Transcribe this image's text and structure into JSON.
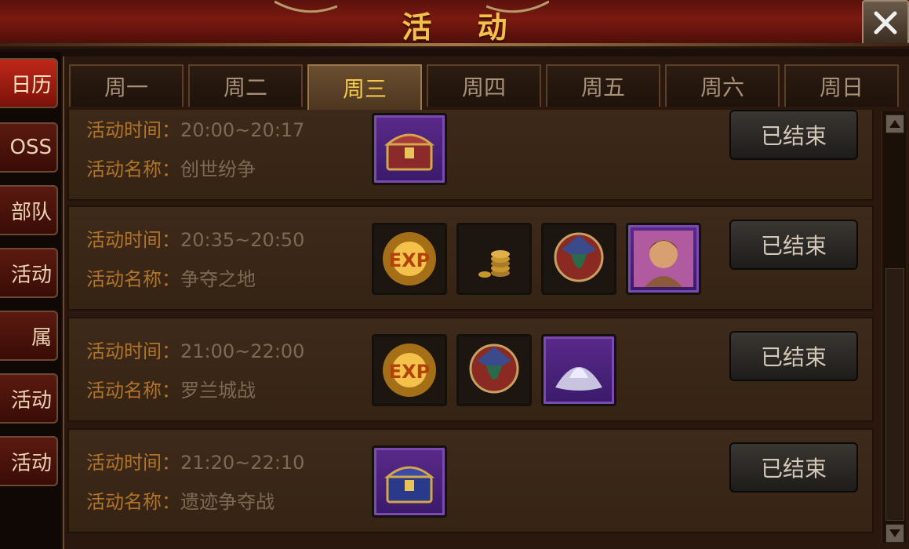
{
  "header": {
    "title": "活动"
  },
  "sidebar": {
    "items": [
      {
        "label": "日历",
        "active": true
      },
      {
        "label": "OSS",
        "active": false
      },
      {
        "label": "部队",
        "active": false
      },
      {
        "label": "活动",
        "active": false
      },
      {
        "label": "属",
        "active": false
      },
      {
        "label": "活动",
        "active": false
      },
      {
        "label": "活动",
        "active": false
      }
    ]
  },
  "tabs": [
    {
      "label": "周一"
    },
    {
      "label": "周二"
    },
    {
      "label": "周三"
    },
    {
      "label": "周四"
    },
    {
      "label": "周五"
    },
    {
      "label": "周六"
    },
    {
      "label": "周日"
    }
  ],
  "active_tab": "周三",
  "labels": {
    "time": "活动时间",
    "name": "活动名称",
    "colon": "："
  },
  "events": [
    {
      "time": "20:00~20:17",
      "name": "创世纷争",
      "status": "已结束",
      "rewards": [
        "treasure-chest-icon"
      ]
    },
    {
      "time": "20:35~20:50",
      "name": "争夺之地",
      "status": "已结束",
      "rewards": [
        "exp-icon",
        "gold-coins-icon",
        "guild-emblem-icon",
        "hero-portrait-icon"
      ]
    },
    {
      "time": "21:00~22:00",
      "name": "罗兰城战",
      "status": "已结束",
      "rewards": [
        "exp-icon",
        "guild-emblem-icon",
        "silver-powder-icon"
      ]
    },
    {
      "time": "21:20~22:10",
      "name": "遗迹争夺战",
      "status": "已结束",
      "rewards": [
        "blue-chest-icon"
      ]
    }
  ],
  "colors": {
    "accent": "#f4c04a",
    "label": "#b0742a",
    "value": "#7e6a54",
    "active_tab_text": "#f4c84a"
  }
}
